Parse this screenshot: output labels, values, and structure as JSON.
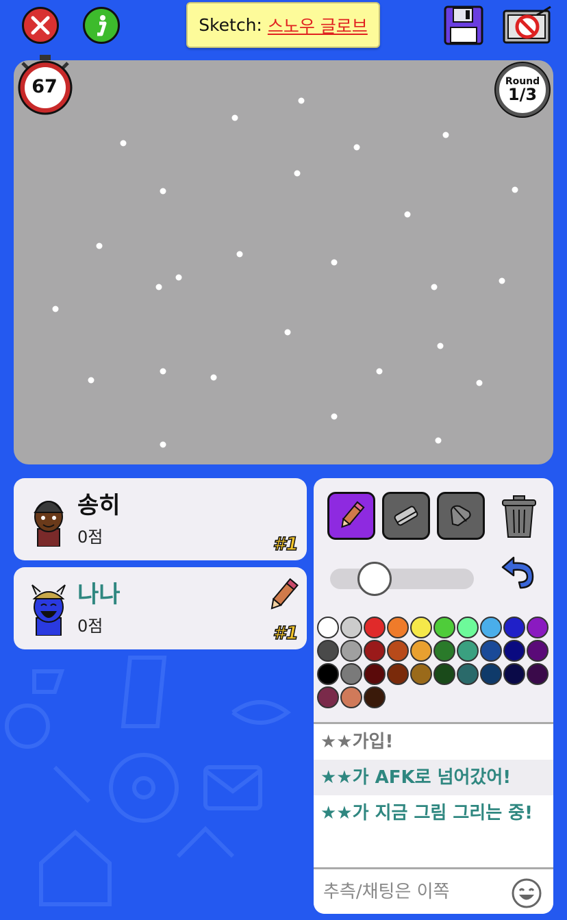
{
  "topbar": {
    "sketch_label": "Sketch:",
    "sketch_word": "스노우 글로브"
  },
  "timer": {
    "seconds": "67"
  },
  "round": {
    "label": "Round",
    "value": "1/3"
  },
  "players": [
    {
      "name": "송히",
      "score": "0점",
      "rank": "#1",
      "drawing": false
    },
    {
      "name": "나나",
      "score": "0점",
      "rank": "#1",
      "drawing": true
    }
  ],
  "tools": {
    "active": "pencil",
    "brush_size_fraction": 0.25
  },
  "palette": [
    "#ffffff",
    "#cccccc",
    "#e02a2a",
    "#ef7b2a",
    "#f5e84a",
    "#4fcc3a",
    "#6dfa9a",
    "#4aaeea",
    "#2020c8",
    "#8a1ac0",
    "#4a4a4a",
    "#a0a0a0",
    "#9a1a1a",
    "#b84a1a",
    "#e8a030",
    "#2a7a2a",
    "#3aa080",
    "#1a4a98",
    "#0a0a80",
    "#5a0a78",
    "#000000",
    "#7a7a7a",
    "#5a0a0a",
    "#7a2a0a",
    "#9a6a1a",
    "#1a4a1a",
    "#2a6a6a",
    "#0f3a6a",
    "#0a0a48",
    "#3a0a4a",
    "#7a2a4a",
    "#d07a5a",
    "#3a1a0a"
  ],
  "chat": {
    "messages": [
      {
        "text": "★★가입!",
        "style": "gray"
      },
      {
        "text": "★★가 AFK로 넘어갔어!",
        "style": "teal"
      },
      {
        "text": "★★가 지금 그림 그리는 중!",
        "style": "teal"
      }
    ],
    "placeholder": "추측/채팅은 이쪽"
  },
  "colors": {
    "background": "#2459f0",
    "canvas": "#a9a8a9",
    "word_box": "#fdfb9a",
    "active_tool": "#8e2ae0",
    "player_teal": "#2f8780"
  }
}
